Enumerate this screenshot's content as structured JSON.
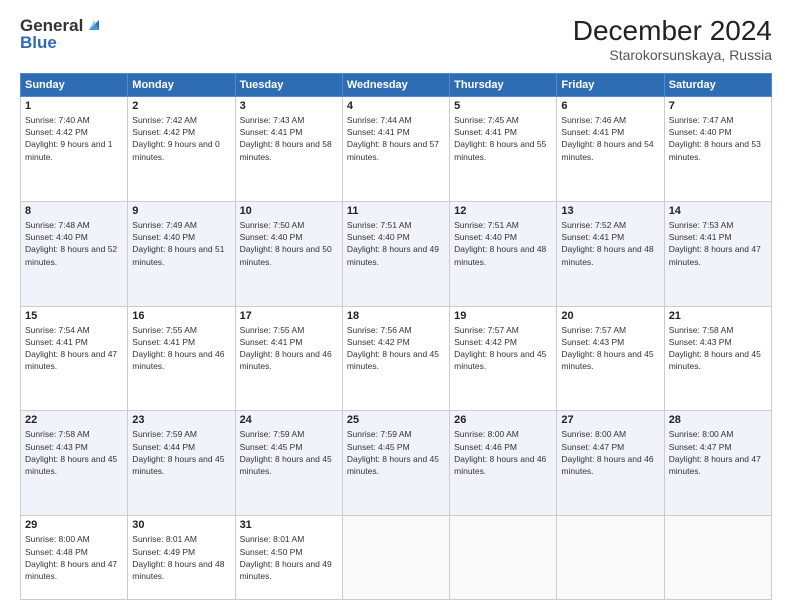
{
  "header": {
    "logo_line1": "General",
    "logo_line2": "Blue",
    "month": "December 2024",
    "location": "Starokorsunskaya, Russia"
  },
  "days_of_week": [
    "Sunday",
    "Monday",
    "Tuesday",
    "Wednesday",
    "Thursday",
    "Friday",
    "Saturday"
  ],
  "weeks": [
    [
      {
        "day": 1,
        "sunrise": "7:40 AM",
        "sunset": "4:42 PM",
        "daylight": "9 hours and 1 minute."
      },
      {
        "day": 2,
        "sunrise": "7:42 AM",
        "sunset": "4:42 PM",
        "daylight": "9 hours and 0 minutes."
      },
      {
        "day": 3,
        "sunrise": "7:43 AM",
        "sunset": "4:41 PM",
        "daylight": "8 hours and 58 minutes."
      },
      {
        "day": 4,
        "sunrise": "7:44 AM",
        "sunset": "4:41 PM",
        "daylight": "8 hours and 57 minutes."
      },
      {
        "day": 5,
        "sunrise": "7:45 AM",
        "sunset": "4:41 PM",
        "daylight": "8 hours and 55 minutes."
      },
      {
        "day": 6,
        "sunrise": "7:46 AM",
        "sunset": "4:41 PM",
        "daylight": "8 hours and 54 minutes."
      },
      {
        "day": 7,
        "sunrise": "7:47 AM",
        "sunset": "4:40 PM",
        "daylight": "8 hours and 53 minutes."
      }
    ],
    [
      {
        "day": 8,
        "sunrise": "7:48 AM",
        "sunset": "4:40 PM",
        "daylight": "8 hours and 52 minutes."
      },
      {
        "day": 9,
        "sunrise": "7:49 AM",
        "sunset": "4:40 PM",
        "daylight": "8 hours and 51 minutes."
      },
      {
        "day": 10,
        "sunrise": "7:50 AM",
        "sunset": "4:40 PM",
        "daylight": "8 hours and 50 minutes."
      },
      {
        "day": 11,
        "sunrise": "7:51 AM",
        "sunset": "4:40 PM",
        "daylight": "8 hours and 49 minutes."
      },
      {
        "day": 12,
        "sunrise": "7:51 AM",
        "sunset": "4:40 PM",
        "daylight": "8 hours and 48 minutes."
      },
      {
        "day": 13,
        "sunrise": "7:52 AM",
        "sunset": "4:41 PM",
        "daylight": "8 hours and 48 minutes."
      },
      {
        "day": 14,
        "sunrise": "7:53 AM",
        "sunset": "4:41 PM",
        "daylight": "8 hours and 47 minutes."
      }
    ],
    [
      {
        "day": 15,
        "sunrise": "7:54 AM",
        "sunset": "4:41 PM",
        "daylight": "8 hours and 47 minutes."
      },
      {
        "day": 16,
        "sunrise": "7:55 AM",
        "sunset": "4:41 PM",
        "daylight": "8 hours and 46 minutes."
      },
      {
        "day": 17,
        "sunrise": "7:55 AM",
        "sunset": "4:41 PM",
        "daylight": "8 hours and 46 minutes."
      },
      {
        "day": 18,
        "sunrise": "7:56 AM",
        "sunset": "4:42 PM",
        "daylight": "8 hours and 45 minutes."
      },
      {
        "day": 19,
        "sunrise": "7:57 AM",
        "sunset": "4:42 PM",
        "daylight": "8 hours and 45 minutes."
      },
      {
        "day": 20,
        "sunrise": "7:57 AM",
        "sunset": "4:43 PM",
        "daylight": "8 hours and 45 minutes."
      },
      {
        "day": 21,
        "sunrise": "7:58 AM",
        "sunset": "4:43 PM",
        "daylight": "8 hours and 45 minutes."
      }
    ],
    [
      {
        "day": 22,
        "sunrise": "7:58 AM",
        "sunset": "4:43 PM",
        "daylight": "8 hours and 45 minutes."
      },
      {
        "day": 23,
        "sunrise": "7:59 AM",
        "sunset": "4:44 PM",
        "daylight": "8 hours and 45 minutes."
      },
      {
        "day": 24,
        "sunrise": "7:59 AM",
        "sunset": "4:45 PM",
        "daylight": "8 hours and 45 minutes."
      },
      {
        "day": 25,
        "sunrise": "7:59 AM",
        "sunset": "4:45 PM",
        "daylight": "8 hours and 45 minutes."
      },
      {
        "day": 26,
        "sunrise": "8:00 AM",
        "sunset": "4:46 PM",
        "daylight": "8 hours and 46 minutes."
      },
      {
        "day": 27,
        "sunrise": "8:00 AM",
        "sunset": "4:47 PM",
        "daylight": "8 hours and 46 minutes."
      },
      {
        "day": 28,
        "sunrise": "8:00 AM",
        "sunset": "4:47 PM",
        "daylight": "8 hours and 47 minutes."
      }
    ],
    [
      {
        "day": 29,
        "sunrise": "8:00 AM",
        "sunset": "4:48 PM",
        "daylight": "8 hours and 47 minutes."
      },
      {
        "day": 30,
        "sunrise": "8:01 AM",
        "sunset": "4:49 PM",
        "daylight": "8 hours and 48 minutes."
      },
      {
        "day": 31,
        "sunrise": "8:01 AM",
        "sunset": "4:50 PM",
        "daylight": "8 hours and 49 minutes."
      },
      null,
      null,
      null,
      null
    ]
  ]
}
